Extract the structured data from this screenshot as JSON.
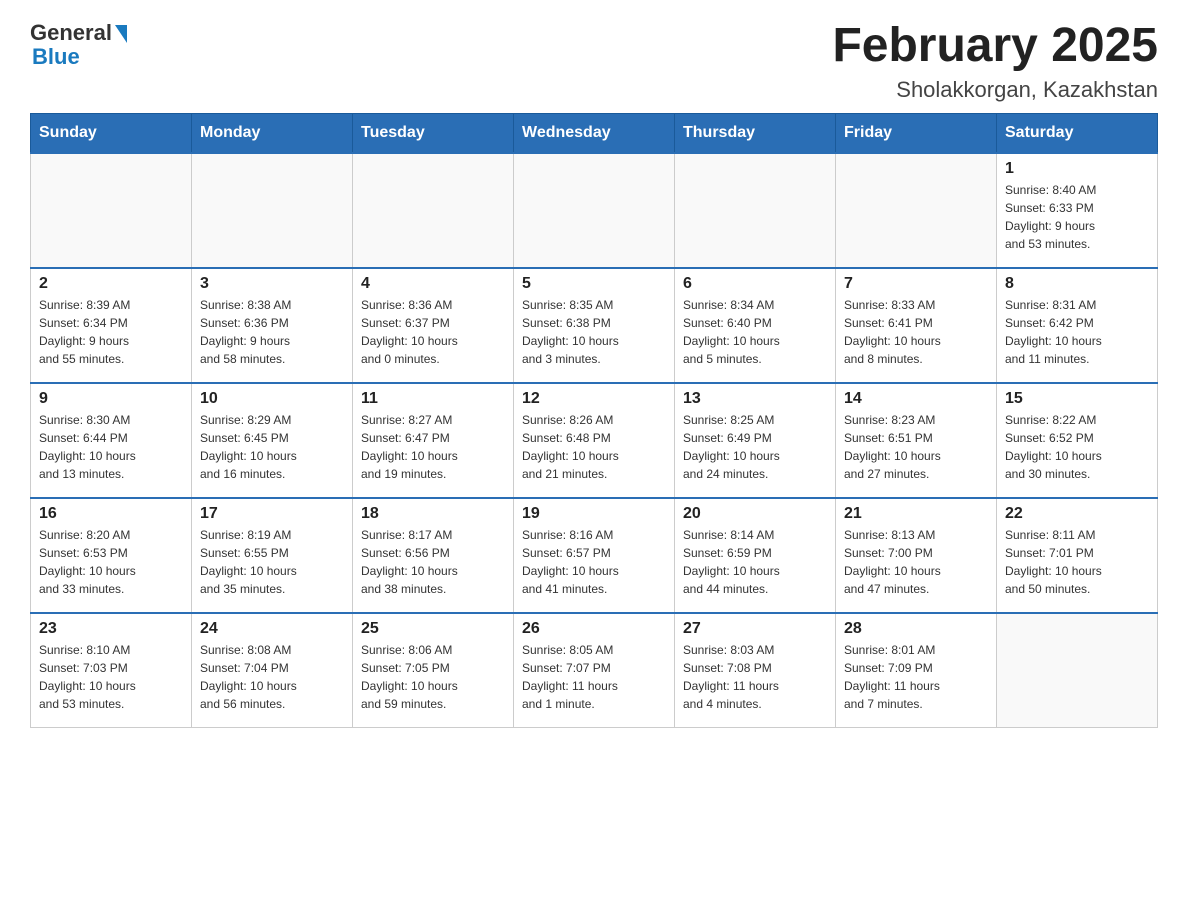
{
  "header": {
    "logo_general": "General",
    "logo_blue": "Blue",
    "month_title": "February 2025",
    "location": "Sholakkorgan, Kazakhstan"
  },
  "weekdays": [
    "Sunday",
    "Monday",
    "Tuesday",
    "Wednesday",
    "Thursday",
    "Friday",
    "Saturday"
  ],
  "weeks": [
    [
      {
        "day": "",
        "info": ""
      },
      {
        "day": "",
        "info": ""
      },
      {
        "day": "",
        "info": ""
      },
      {
        "day": "",
        "info": ""
      },
      {
        "day": "",
        "info": ""
      },
      {
        "day": "",
        "info": ""
      },
      {
        "day": "1",
        "info": "Sunrise: 8:40 AM\nSunset: 6:33 PM\nDaylight: 9 hours\nand 53 minutes."
      }
    ],
    [
      {
        "day": "2",
        "info": "Sunrise: 8:39 AM\nSunset: 6:34 PM\nDaylight: 9 hours\nand 55 minutes."
      },
      {
        "day": "3",
        "info": "Sunrise: 8:38 AM\nSunset: 6:36 PM\nDaylight: 9 hours\nand 58 minutes."
      },
      {
        "day": "4",
        "info": "Sunrise: 8:36 AM\nSunset: 6:37 PM\nDaylight: 10 hours\nand 0 minutes."
      },
      {
        "day": "5",
        "info": "Sunrise: 8:35 AM\nSunset: 6:38 PM\nDaylight: 10 hours\nand 3 minutes."
      },
      {
        "day": "6",
        "info": "Sunrise: 8:34 AM\nSunset: 6:40 PM\nDaylight: 10 hours\nand 5 minutes."
      },
      {
        "day": "7",
        "info": "Sunrise: 8:33 AM\nSunset: 6:41 PM\nDaylight: 10 hours\nand 8 minutes."
      },
      {
        "day": "8",
        "info": "Sunrise: 8:31 AM\nSunset: 6:42 PM\nDaylight: 10 hours\nand 11 minutes."
      }
    ],
    [
      {
        "day": "9",
        "info": "Sunrise: 8:30 AM\nSunset: 6:44 PM\nDaylight: 10 hours\nand 13 minutes."
      },
      {
        "day": "10",
        "info": "Sunrise: 8:29 AM\nSunset: 6:45 PM\nDaylight: 10 hours\nand 16 minutes."
      },
      {
        "day": "11",
        "info": "Sunrise: 8:27 AM\nSunset: 6:47 PM\nDaylight: 10 hours\nand 19 minutes."
      },
      {
        "day": "12",
        "info": "Sunrise: 8:26 AM\nSunset: 6:48 PM\nDaylight: 10 hours\nand 21 minutes."
      },
      {
        "day": "13",
        "info": "Sunrise: 8:25 AM\nSunset: 6:49 PM\nDaylight: 10 hours\nand 24 minutes."
      },
      {
        "day": "14",
        "info": "Sunrise: 8:23 AM\nSunset: 6:51 PM\nDaylight: 10 hours\nand 27 minutes."
      },
      {
        "day": "15",
        "info": "Sunrise: 8:22 AM\nSunset: 6:52 PM\nDaylight: 10 hours\nand 30 minutes."
      }
    ],
    [
      {
        "day": "16",
        "info": "Sunrise: 8:20 AM\nSunset: 6:53 PM\nDaylight: 10 hours\nand 33 minutes."
      },
      {
        "day": "17",
        "info": "Sunrise: 8:19 AM\nSunset: 6:55 PM\nDaylight: 10 hours\nand 35 minutes."
      },
      {
        "day": "18",
        "info": "Sunrise: 8:17 AM\nSunset: 6:56 PM\nDaylight: 10 hours\nand 38 minutes."
      },
      {
        "day": "19",
        "info": "Sunrise: 8:16 AM\nSunset: 6:57 PM\nDaylight: 10 hours\nand 41 minutes."
      },
      {
        "day": "20",
        "info": "Sunrise: 8:14 AM\nSunset: 6:59 PM\nDaylight: 10 hours\nand 44 minutes."
      },
      {
        "day": "21",
        "info": "Sunrise: 8:13 AM\nSunset: 7:00 PM\nDaylight: 10 hours\nand 47 minutes."
      },
      {
        "day": "22",
        "info": "Sunrise: 8:11 AM\nSunset: 7:01 PM\nDaylight: 10 hours\nand 50 minutes."
      }
    ],
    [
      {
        "day": "23",
        "info": "Sunrise: 8:10 AM\nSunset: 7:03 PM\nDaylight: 10 hours\nand 53 minutes."
      },
      {
        "day": "24",
        "info": "Sunrise: 8:08 AM\nSunset: 7:04 PM\nDaylight: 10 hours\nand 56 minutes."
      },
      {
        "day": "25",
        "info": "Sunrise: 8:06 AM\nSunset: 7:05 PM\nDaylight: 10 hours\nand 59 minutes."
      },
      {
        "day": "26",
        "info": "Sunrise: 8:05 AM\nSunset: 7:07 PM\nDaylight: 11 hours\nand 1 minute."
      },
      {
        "day": "27",
        "info": "Sunrise: 8:03 AM\nSunset: 7:08 PM\nDaylight: 11 hours\nand 4 minutes."
      },
      {
        "day": "28",
        "info": "Sunrise: 8:01 AM\nSunset: 7:09 PM\nDaylight: 11 hours\nand 7 minutes."
      },
      {
        "day": "",
        "info": ""
      }
    ]
  ]
}
